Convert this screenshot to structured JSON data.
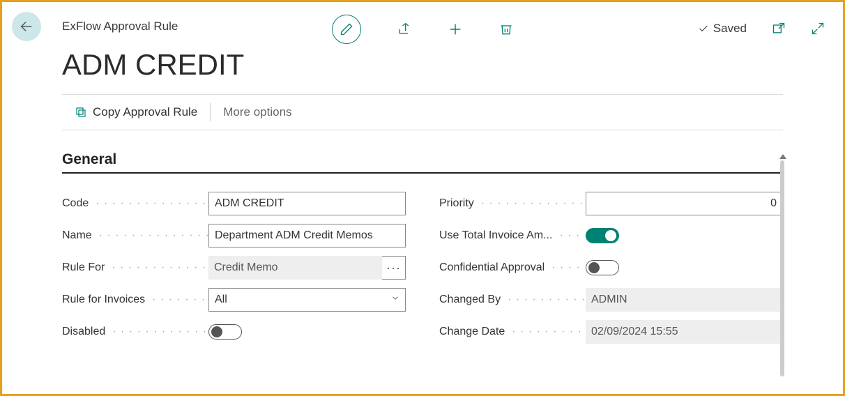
{
  "header": {
    "page_type": "ExFlow Approval Rule",
    "saved_label": "Saved"
  },
  "title": "ADM CREDIT",
  "actions": {
    "copy_rule": "Copy Approval Rule",
    "more_options": "More options"
  },
  "section": {
    "general": "General"
  },
  "fields": {
    "code": {
      "label": "Code",
      "value": "ADM CREDIT"
    },
    "name": {
      "label": "Name",
      "value": "Department ADM Credit Memos"
    },
    "rule_for": {
      "label": "Rule For",
      "value": "Credit Memo"
    },
    "rule_for_invoices": {
      "label": "Rule for Invoices",
      "value": "All"
    },
    "disabled": {
      "label": "Disabled",
      "value": false
    },
    "priority": {
      "label": "Priority",
      "value": "0"
    },
    "use_total_invoice_amount": {
      "label": "Use Total Invoice Am...",
      "value": true
    },
    "confidential_approval": {
      "label": "Confidential Approval",
      "value": false
    },
    "changed_by": {
      "label": "Changed By",
      "value": "ADMIN"
    },
    "change_date": {
      "label": "Change Date",
      "value": "02/09/2024 15:55"
    }
  }
}
